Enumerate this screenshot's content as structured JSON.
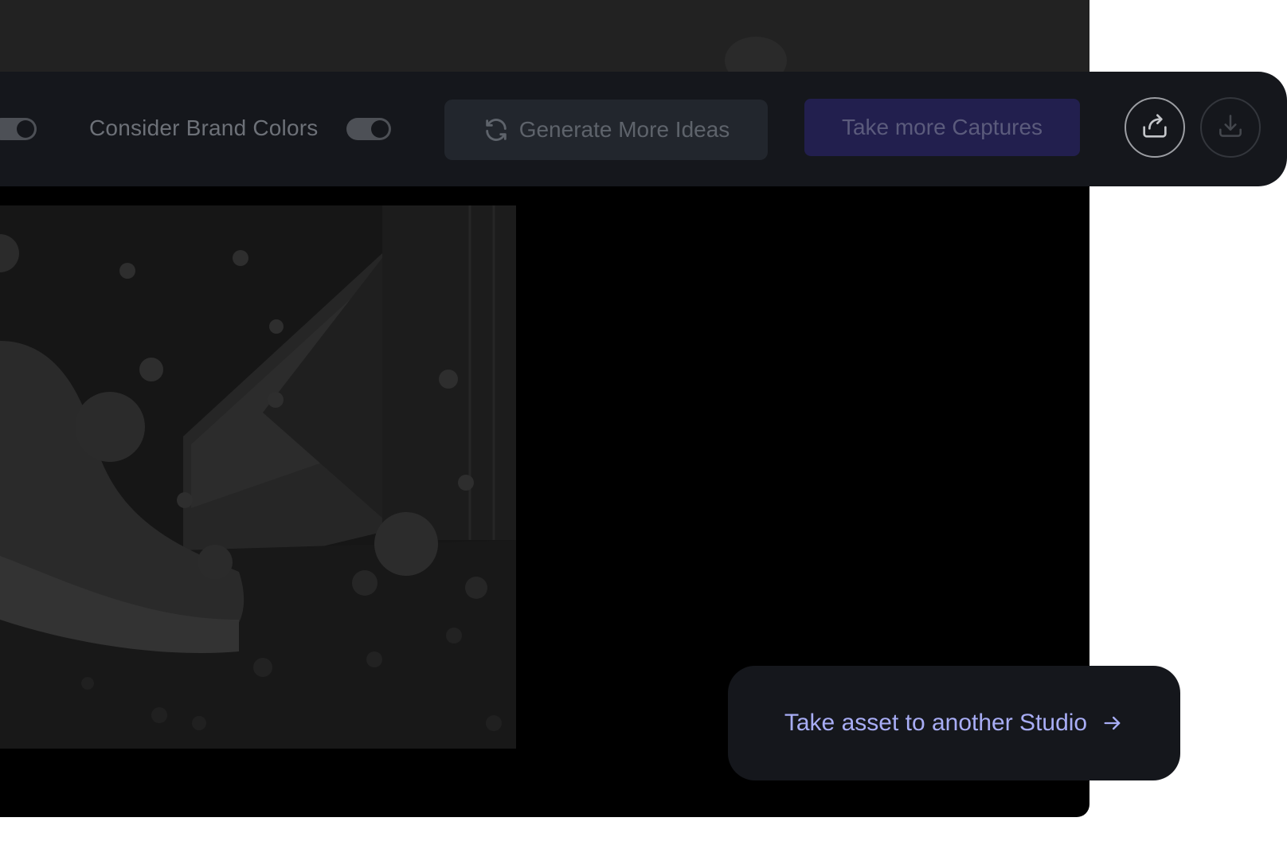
{
  "toolbar": {
    "brand_colors_label": "Consider Brand Colors",
    "generate_label": "Generate More Ideas",
    "capture_label": "Take more Captures",
    "share_icon": "share-icon",
    "download_icon": "download-icon",
    "refresh_icon": "refresh-icon"
  },
  "studio_card": {
    "label": "Take asset to another Studio",
    "arrow_icon": "arrow-right-icon"
  },
  "colors": {
    "toolbar_bg": "#15171c",
    "primary_button": "#221f4e",
    "link_text": "#a8adf5"
  }
}
